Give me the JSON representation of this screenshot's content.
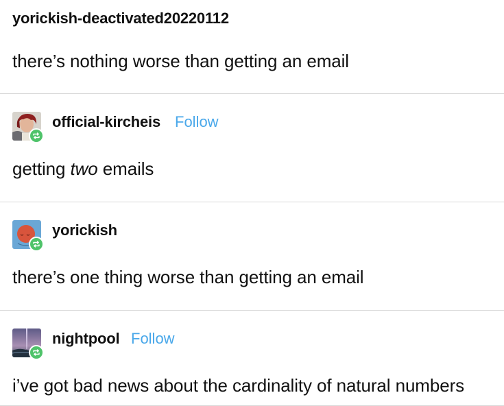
{
  "posts": [
    {
      "username": "yorickish-deactivated20220112",
      "text": "there’s nothing worse than getting an email"
    },
    {
      "username": "official-kircheis",
      "follow": "Follow",
      "text_before": "getting ",
      "text_italic": "two",
      "text_after": " emails"
    },
    {
      "username": "yorickish",
      "text": "there’s one thing worse than getting an email"
    },
    {
      "username": "nightpool",
      "follow": "Follow",
      "text": "i’ve got bad news about the cardinality of natural numbers"
    }
  ],
  "colors": {
    "follow": "#4aa8ea",
    "reblog_badge": "#4fc36a",
    "divider": "#d9d9d9"
  },
  "icons": {
    "reblog": "reblog-icon"
  }
}
